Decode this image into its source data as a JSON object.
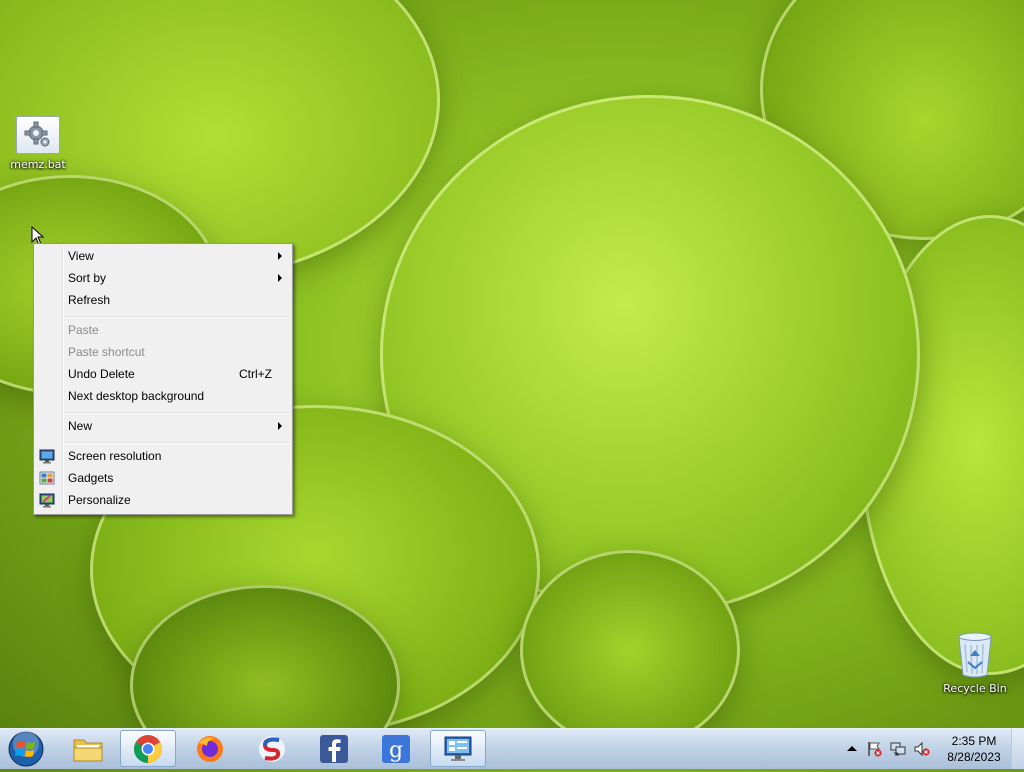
{
  "desktop": {
    "icons": [
      {
        "label": "memz.bat",
        "icon": "batch-file-gear-icon"
      },
      {
        "label": "Recycle Bin",
        "icon": "recycle-bin-icon"
      }
    ]
  },
  "context_menu": {
    "items": [
      {
        "label": "View",
        "submenu": true
      },
      {
        "label": "Sort by",
        "submenu": true
      },
      {
        "label": "Refresh"
      },
      {
        "label": "Paste",
        "disabled": true
      },
      {
        "label": "Paste shortcut",
        "disabled": true
      },
      {
        "label": "Undo Delete",
        "shortcut": "Ctrl+Z"
      },
      {
        "label": "Next desktop background"
      },
      {
        "label": "New",
        "submenu": true
      },
      {
        "label": "Screen resolution",
        "icon": "monitor-icon"
      },
      {
        "label": "Gadgets",
        "icon": "gadgets-icon"
      },
      {
        "label": "Personalize",
        "icon": "personalize-icon"
      }
    ]
  },
  "taskbar": {
    "start": {
      "icon": "windows-orb-icon"
    },
    "pinned": [
      {
        "name": "file-explorer",
        "icon": "folder-icon"
      },
      {
        "name": "google-chrome",
        "icon": "chrome-icon",
        "active": true
      },
      {
        "name": "firefox",
        "icon": "firefox-icon"
      },
      {
        "name": "app-s",
        "icon": "swirl-s-icon"
      },
      {
        "name": "facebook",
        "icon": "facebook-icon"
      },
      {
        "name": "google",
        "icon": "google-g-icon"
      },
      {
        "name": "control-panel",
        "icon": "control-panel-icon",
        "active": true
      }
    ],
    "tray": {
      "icons": [
        "show-hidden-icons-arrow",
        "action-center-flag-icon",
        "network-icon",
        "volume-muted-icon"
      ],
      "time": "2:35 PM",
      "date": "8/28/2023"
    }
  },
  "colors": {
    "menu_bg": "#f0f0f0",
    "menu_disabled_text": "#8a8a8a",
    "taskbar_top": "#dfe9f5",
    "taskbar_bottom": "#a9bfd9"
  }
}
